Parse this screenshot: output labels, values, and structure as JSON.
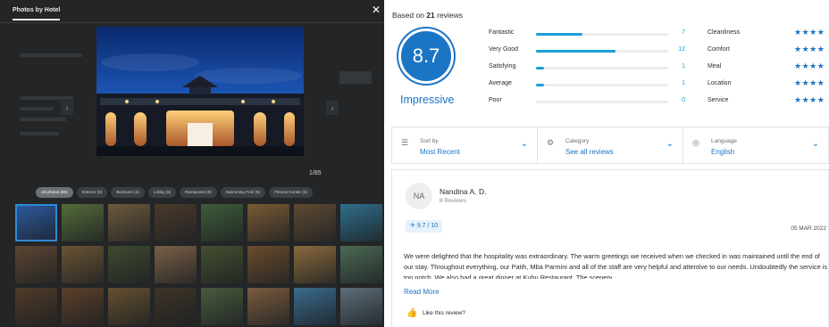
{
  "gallery": {
    "tab_label": "Photos by Hotel",
    "close_icon": "close-icon",
    "prev_icon": "chevron-left-icon",
    "next_icon": "chevron-right-icon",
    "counter": "1/85",
    "filters": [
      {
        "label": "All photos (85)",
        "active": true
      },
      {
        "label": "Exterior (5)",
        "active": false
      },
      {
        "label": "Bedroom (4)",
        "active": false
      },
      {
        "label": "Lobby (5)",
        "active": false
      },
      {
        "label": "Restaurant (9)",
        "active": false
      },
      {
        "label": "Swimming Pool (6)",
        "active": false
      },
      {
        "label": "Fitness Center (3)",
        "active": false
      }
    ],
    "thumbnail_count": 24,
    "selected_thumbnail": 1
  },
  "reviews": {
    "based_on_prefix": "Based on",
    "based_on_count": "21",
    "based_on_suffix": "reviews",
    "score": "8.7",
    "score_label": "Impressive",
    "distribution": [
      {
        "label": "Fantastic",
        "count": 7
      },
      {
        "label": "Very Good",
        "count": 12
      },
      {
        "label": "Satisfying",
        "count": 1
      },
      {
        "label": "Average",
        "count": 1
      },
      {
        "label": "Poor",
        "count": 0
      }
    ],
    "aspects": [
      {
        "label": "Cleanliness",
        "stars": "★★★★"
      },
      {
        "label": "Comfort",
        "stars": "★★★★"
      },
      {
        "label": "Meal",
        "stars": "★★★★"
      },
      {
        "label": "Location",
        "stars": "★★★★"
      },
      {
        "label": "Service",
        "stars": "★★★★"
      }
    ],
    "sort": {
      "caption": "Sort by",
      "value": "Most Recent",
      "icon": "sort-icon"
    },
    "category": {
      "caption": "Category",
      "value": "See all reviews",
      "icon": "sliders-icon"
    },
    "language": {
      "caption": "Language",
      "value": "English",
      "icon": "globe-icon"
    },
    "review": {
      "initials": "NA",
      "name": "Nandina A. D.",
      "meta": "8 Reviews",
      "rating": "9.7 / 10",
      "rating_icon": "bird-icon",
      "date": "05 MAR 2022",
      "text": "We were delighted that the hospitality was extraordinary. The warm greetings we received when we checked in was maintained until the end of our stay. Throughout everything, our Patih, Mba Parmini and all of the staff are very helpful and attentive to our needs. Undoubtedly the service is top notch. We also had a great dinner at Kubu Restaurant. The scenery",
      "read_more": "Read More",
      "like_label": "Like this review?",
      "like_icon": "thumbs-up-icon"
    },
    "colors": {
      "accent": "#1a75c4",
      "bar": "#1a9fd6"
    }
  }
}
